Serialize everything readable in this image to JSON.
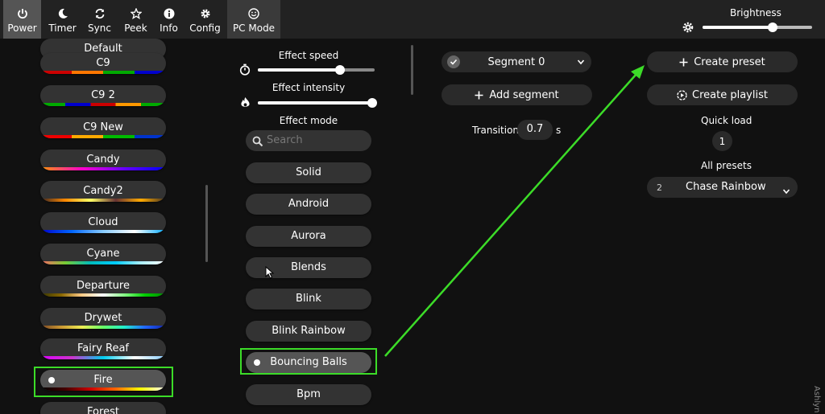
{
  "nav": {
    "items": [
      {
        "label": "Power",
        "icon": "power-icon"
      },
      {
        "label": "Timer",
        "icon": "moon-icon"
      },
      {
        "label": "Sync",
        "icon": "sync-icon"
      },
      {
        "label": "Peek",
        "icon": "star-icon"
      },
      {
        "label": "Info",
        "icon": "info-icon"
      },
      {
        "label": "Config",
        "icon": "gear-icon"
      },
      {
        "label": "PC Mode",
        "icon": "smiley-icon"
      }
    ]
  },
  "brightness": {
    "label": "Brightness",
    "level": 0.64
  },
  "palettes": {
    "items": [
      {
        "label": "Default"
      },
      {
        "label": "C9"
      },
      {
        "label": "C9 2"
      },
      {
        "label": "C9 New"
      },
      {
        "label": "Candy"
      },
      {
        "label": "Candy2"
      },
      {
        "label": "Cloud"
      },
      {
        "label": "Cyane"
      },
      {
        "label": "Departure"
      },
      {
        "label": "Drywet"
      },
      {
        "label": "Fairy Reaf"
      },
      {
        "label": "Fire"
      },
      {
        "label": "Forest"
      }
    ],
    "selected": "Fire"
  },
  "effect_controls": {
    "speed_label": "Effect speed",
    "speed_level": 0.7,
    "intensity_label": "Effect intensity",
    "intensity_level": 0.98,
    "mode_label": "Effect mode",
    "search_placeholder": "Search"
  },
  "effects": {
    "items": [
      {
        "label": "Solid"
      },
      {
        "label": "Android"
      },
      {
        "label": "Aurora"
      },
      {
        "label": "Blends"
      },
      {
        "label": "Blink"
      },
      {
        "label": "Blink Rainbow"
      },
      {
        "label": "Bouncing Balls"
      },
      {
        "label": "Bpm"
      }
    ],
    "selected": "Bouncing Balls"
  },
  "segment": {
    "selector_label": "Segment 0",
    "add_label": "Add segment",
    "transition_label": "Transition:",
    "transition_value": "0.7",
    "transition_unit": "s"
  },
  "presets": {
    "create_preset_label": "Create preset",
    "create_playlist_label": "Create playlist",
    "quick_load_label": "Quick load",
    "quick_load_value": "1",
    "all_presets_label": "All presets",
    "selected_number": "2",
    "selected_name": "Chase Rainbow"
  },
  "annotation": {
    "color": "#3cdc28"
  },
  "watermark": "Ashlyn"
}
